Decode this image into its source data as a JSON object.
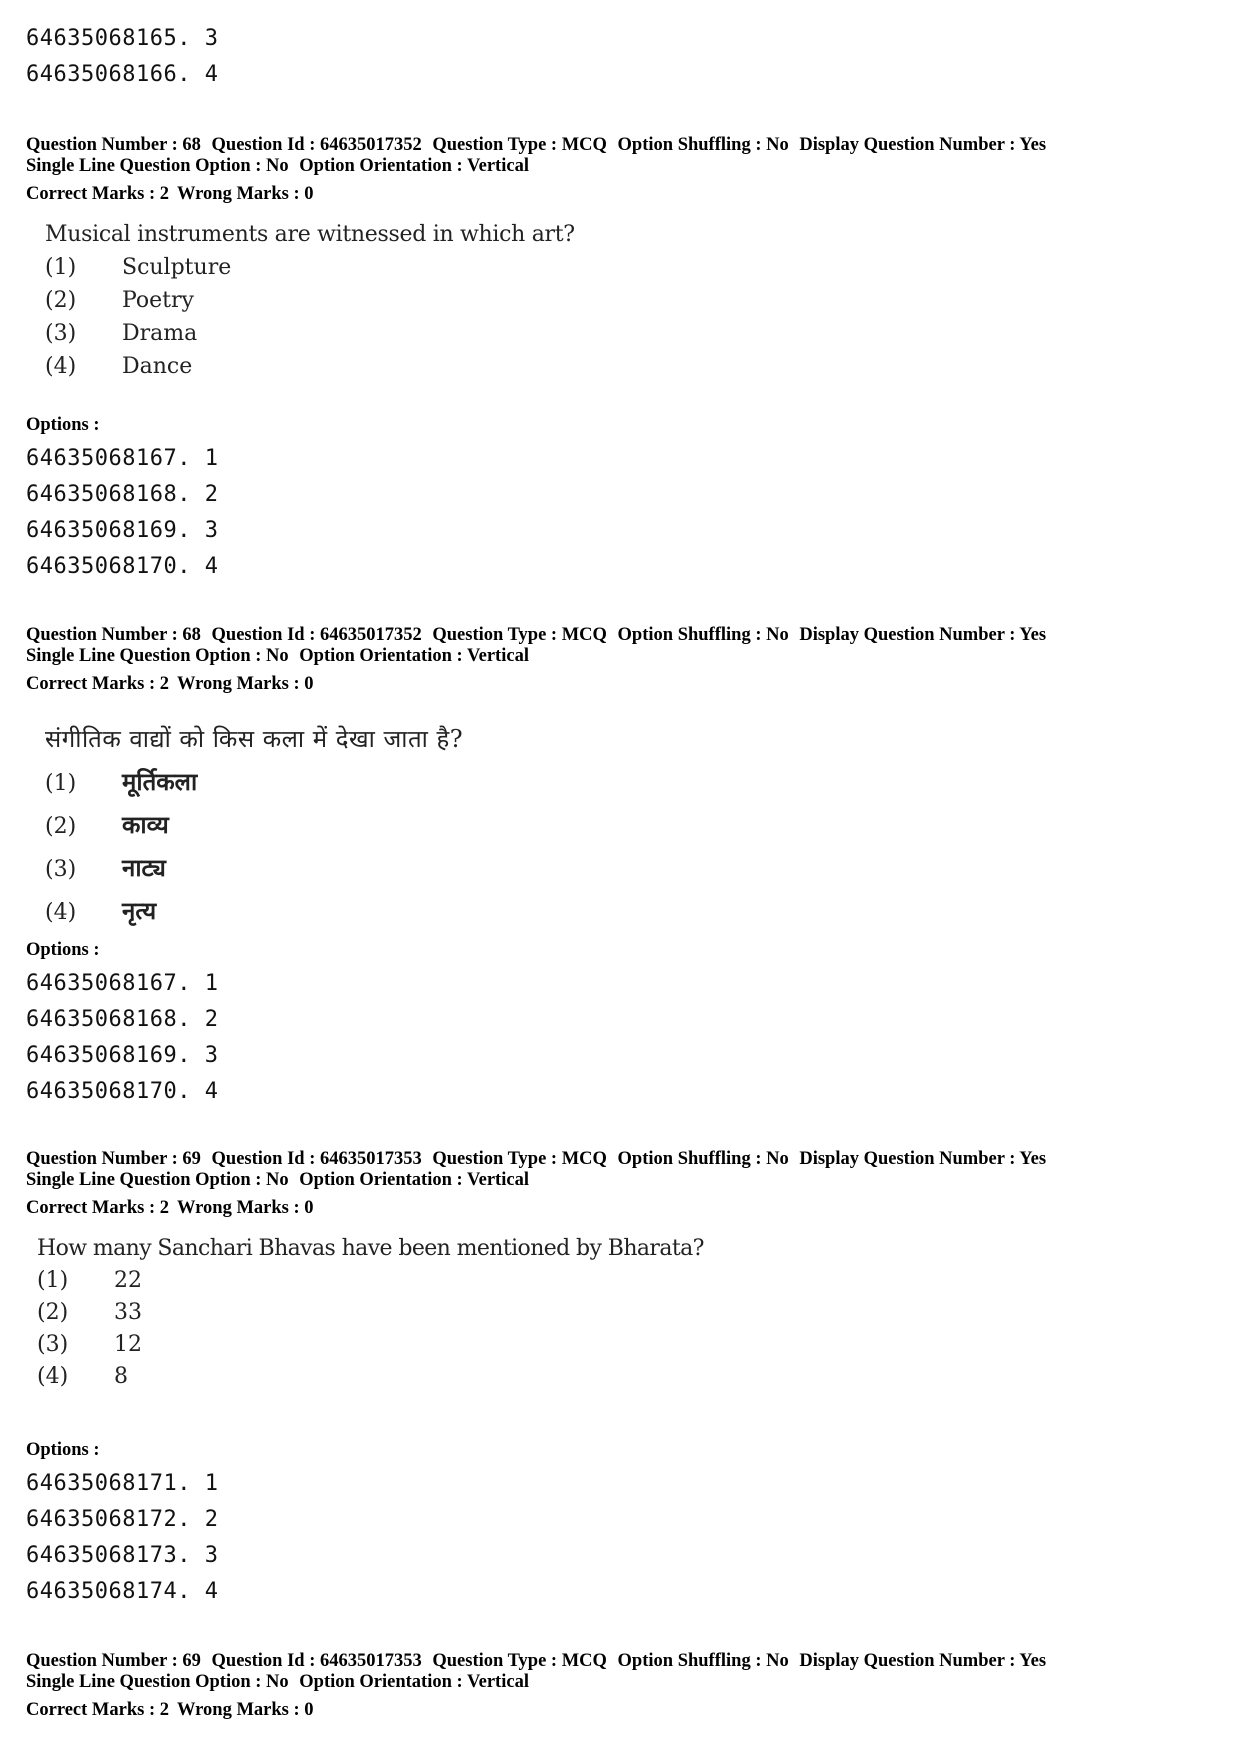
{
  "top_options": [
    {
      "id": "64635068165",
      "n": "3"
    },
    {
      "id": "64635068166",
      "n": "4"
    }
  ],
  "labels": {
    "options": "Options :"
  },
  "blocks": [
    {
      "header": {
        "line1": [
          "Question Number : 68",
          "Question Id : 64635017352",
          "Question Type : MCQ",
          "Option Shuffling : No",
          "Display Question Number : Yes"
        ],
        "line2": [
          "Single Line Question Option : No",
          "Option Orientation : Vertical"
        ]
      },
      "marks": [
        "Correct Marks : 2",
        "Wrong Marks : 0"
      ],
      "question": "Musical instruments are witnessed in which art?",
      "choices": [
        {
          "num": "(1)",
          "text": "Sculpture"
        },
        {
          "num": "(2)",
          "text": "Poetry"
        },
        {
          "num": "(3)",
          "text": "Drama"
        },
        {
          "num": "(4)",
          "text": "Dance"
        }
      ],
      "options": [
        {
          "id": "64635068167",
          "n": "1"
        },
        {
          "id": "64635068168",
          "n": "2"
        },
        {
          "id": "64635068169",
          "n": "3"
        },
        {
          "id": "64635068170",
          "n": "4"
        }
      ]
    },
    {
      "header": {
        "line1": [
          "Question Number : 68",
          "Question Id : 64635017352",
          "Question Type : MCQ",
          "Option Shuffling : No",
          "Display Question Number : Yes"
        ],
        "line2": [
          "Single Line Question Option : No",
          "Option Orientation : Vertical"
        ]
      },
      "marks": [
        "Correct Marks : 2",
        "Wrong Marks : 0"
      ],
      "question": "संगीतिक वाद्यों को किस कला में देखा जाता है?",
      "choices": [
        {
          "num": "(1)",
          "text": "मूर्तिकला"
        },
        {
          "num": "(2)",
          "text": "काव्य"
        },
        {
          "num": "(3)",
          "text": "नाट्य"
        },
        {
          "num": "(4)",
          "text": "नृत्य"
        }
      ],
      "options": [
        {
          "id": "64635068167",
          "n": "1"
        },
        {
          "id": "64635068168",
          "n": "2"
        },
        {
          "id": "64635068169",
          "n": "3"
        },
        {
          "id": "64635068170",
          "n": "4"
        }
      ]
    },
    {
      "header": {
        "line1": [
          "Question Number : 69",
          "Question Id : 64635017353",
          "Question Type : MCQ",
          "Option Shuffling : No",
          "Display Question Number : Yes"
        ],
        "line2": [
          "Single Line Question Option : No",
          "Option Orientation : Vertical"
        ]
      },
      "marks": [
        "Correct Marks : 2",
        "Wrong Marks : 0"
      ],
      "question": "How many Sanchari Bhavas have been mentioned by Bharata?",
      "choices": [
        {
          "num": "(1)",
          "text": "22"
        },
        {
          "num": "(2)",
          "text": "33"
        },
        {
          "num": "(3)",
          "text": "12"
        },
        {
          "num": "(4)",
          "text": "8"
        }
      ],
      "options": [
        {
          "id": "64635068171",
          "n": "1"
        },
        {
          "id": "64635068172",
          "n": "2"
        },
        {
          "id": "64635068173",
          "n": "3"
        },
        {
          "id": "64635068174",
          "n": "4"
        }
      ]
    },
    {
      "header": {
        "line1": [
          "Question Number : 69",
          "Question Id : 64635017353",
          "Question Type : MCQ",
          "Option Shuffling : No",
          "Display Question Number : Yes"
        ],
        "line2": [
          "Single Line Question Option : No",
          "Option Orientation : Vertical"
        ]
      },
      "marks": [
        "Correct Marks : 2",
        "Wrong Marks : 0"
      ]
    }
  ]
}
